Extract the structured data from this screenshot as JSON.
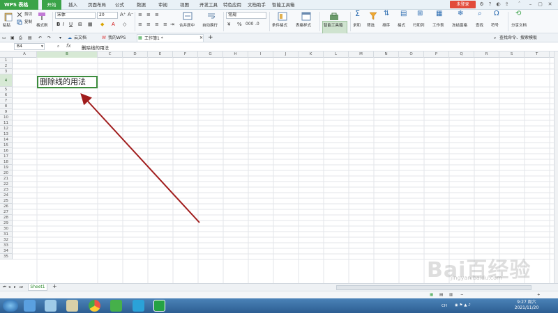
{
  "app": {
    "wps_menu": "WPS 表格"
  },
  "menu_tabs": [
    "开始",
    "插入",
    "页面布局",
    "公式",
    "数据",
    "审阅",
    "视图",
    "开发工具",
    "特色应用",
    "文档助手",
    "智能工具箱"
  ],
  "login_label": "未登录",
  "ribbon": {
    "paste": "粘贴",
    "cut": "剪切",
    "copy": "复制",
    "format_painter": "格式刷",
    "font_name": "宋体",
    "font_size": "20",
    "merge_center": "合并居中",
    "wrap_text": "自动换行",
    "number_format": "常规",
    "percent": "%",
    "cond_format": "条件格式",
    "table_style": "表格样式",
    "smart_toolbox": "智能工具箱",
    "sum": "求和",
    "filter": "筛选",
    "sort": "排序",
    "format": "格式",
    "row_col": "行和列",
    "worksheet": "工作表",
    "freeze": "冻结窗格",
    "find": "查找",
    "symbol": "符号",
    "share": "分享文档"
  },
  "doc_tabs": [
    "云文档",
    "我的WPS",
    "工作簿1 *"
  ],
  "search_cmd": "查找命令、搜索模板",
  "formula": {
    "cell_ref": "B4",
    "fx": "fx",
    "value": "删除线的用法"
  },
  "columns": [
    "A",
    "B",
    "C",
    "D",
    "E",
    "F",
    "G",
    "H",
    "I",
    "J",
    "K",
    "L",
    "M",
    "N",
    "O",
    "P",
    "Q",
    "R",
    "S",
    "T"
  ],
  "rows": [
    "1",
    "2",
    "3",
    "4",
    "5",
    "6",
    "7",
    "8",
    "9",
    "10",
    "11",
    "12",
    "13",
    "14",
    "15",
    "16",
    "17",
    "18",
    "19",
    "20",
    "21",
    "22",
    "23",
    "24",
    "25",
    "26",
    "27",
    "28",
    "29",
    "30",
    "31",
    "32",
    "33",
    "34",
    "35"
  ],
  "cell_b4": "删除线的用法",
  "sheet_tab": "Sheet1",
  "taskbar": {
    "time": "9:27 周六",
    "date": "2021/11/20",
    "ime": "CH"
  },
  "watermark": {
    "main": "Bai百经验",
    "sub": "jingyan.baidu.com"
  },
  "colors": {
    "accent": "#3aa348",
    "arrow": "#a01c1c",
    "login": "#e24b3b"
  }
}
